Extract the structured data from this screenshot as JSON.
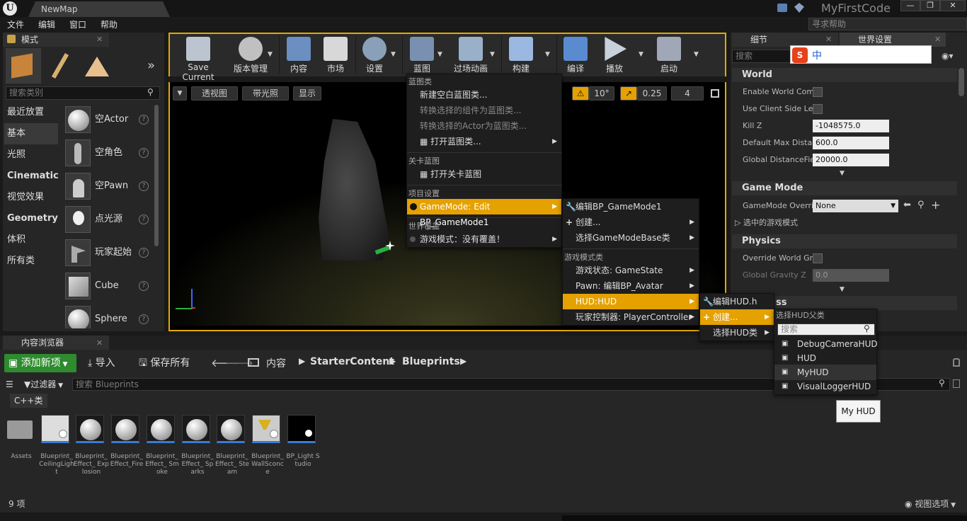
{
  "titlebar": {
    "tab_title": "NewMap",
    "project_name": "MyFirstCode"
  },
  "menubar": {
    "items": [
      "文件",
      "编辑",
      "窗口",
      "帮助"
    ],
    "help_search_placeholder": "寻求帮助"
  },
  "modes_panel": {
    "tab_label": "模式",
    "search_placeholder": "搜索类别",
    "categories": [
      "最近放置",
      "基本",
      "光照",
      "Cinematic",
      "视觉效果",
      "Geometry",
      "体积",
      "所有类"
    ],
    "actors": [
      "空Actor",
      "空角色",
      "空Pawn",
      "点光源",
      "玩家起始",
      "Cube",
      "Sphere"
    ]
  },
  "toolbar": {
    "buttons": [
      "Save Current",
      "版本管理",
      "内容",
      "市场",
      "设置",
      "蓝图",
      "过场动画",
      "构建",
      "编译",
      "播放",
      "启动"
    ]
  },
  "viewport": {
    "perspective_label": "透视图",
    "lit_label": "带光照",
    "show_label": "显示",
    "rotation_snap": "10°",
    "scale_snap": "0.25",
    "camera_speed": "4"
  },
  "blueprint_menu": {
    "section_blueprint_class": "蓝图类",
    "new_empty": "新建空白蓝图类...",
    "convert_component": "转换选择的组件为蓝图类...",
    "convert_actor": "转换选择的Actor为蓝图类...",
    "open_blueprint": "打开蓝图类...",
    "section_level": "关卡蓝图",
    "open_level": "打开关卡蓝图",
    "section_project": "项目设置",
    "gamemode_edit": "GameMode: Edit BP_GameMode1",
    "section_world": "世界覆盖",
    "game_mode_none": "游戏模式：没有覆盖！"
  },
  "gamemode_submenu": {
    "edit": "编辑BP_GameMode1",
    "create": "创建...",
    "select_base": "选择GameModeBase类",
    "section_classes": "游戏模式类",
    "game_state": "游戏状态: GameState",
    "pawn": "Pawn: 编辑BP_Avatar",
    "hud": "HUD:HUD",
    "player_controller": "玩家控制器: PlayerController"
  },
  "hud_submenu": {
    "edit": "编辑HUD.h",
    "create": "创建...",
    "select": "选择HUD类"
  },
  "hud_parent_picker": {
    "title": "选择HUD父类",
    "search_placeholder": "搜索",
    "classes": [
      "DebugCameraHUD",
      "HUD",
      "MyHUD",
      "VisualLoggerHUD"
    ],
    "tooltip": "My HUD"
  },
  "details_panel": {
    "tab_details": "细节",
    "tab_world_settings": "世界设置",
    "search_placeholder": "搜索",
    "sections": {
      "world": "World",
      "game_mode": "Game Mode",
      "physics": "Physics",
      "partial": "ss"
    },
    "props": {
      "enable_world_comp": "Enable World Comp",
      "use_client_side": "Use Client Side Le",
      "kill_z": "Kill Z",
      "kill_z_value": "-1048575.0",
      "default_max_dist": "Default Max Distar",
      "default_max_dist_value": "600.0",
      "global_distance": "Global DistanceFie",
      "global_distance_value": "20000.0",
      "gamemode_override": "GameMode Overri",
      "gamemode_override_value": "None",
      "selected_gamemode": "选中的游戏模式",
      "override_world_gravity": "Override World Gra",
      "global_gravity_z": "Global Gravity Z",
      "global_gravity_z_value": "0.0"
    }
  },
  "content_browser": {
    "tab_label": "内容浏览器",
    "add_new": "添加新项",
    "import": "导入",
    "save_all": "保存所有",
    "breadcrumb": [
      "内容",
      "StarterContent",
      "Blueprints"
    ],
    "filter_label": "过滤器",
    "search_placeholder": "搜索 Blueprints",
    "cpp_classes": "C++类",
    "assets": [
      "Assets",
      "Blueprint_ CeilingLight",
      "Blueprint_ Effect_ Explosion",
      "Blueprint_ Effect_Fire",
      "Blueprint_ Effect_ Smoke",
      "Blueprint_ Effect_ Sparks",
      "Blueprint_ Effect_ Steam",
      "Blueprint_ WallSconce",
      "BP_Light Studio"
    ],
    "item_count": "9 项",
    "view_options": "视图选项"
  },
  "ime_toolbar": {
    "lang": "中"
  }
}
